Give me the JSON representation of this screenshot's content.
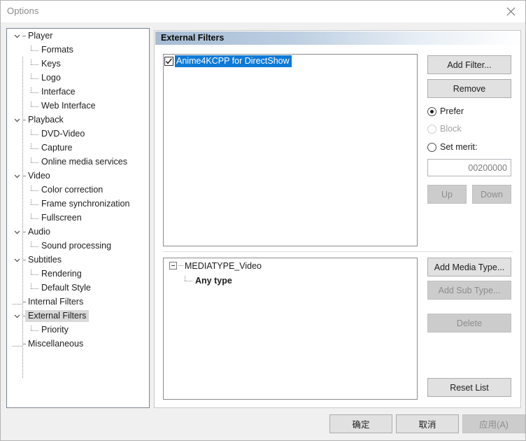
{
  "window": {
    "title": "Options",
    "close_icon": "close-icon"
  },
  "sidebar": {
    "items": [
      {
        "label": "Player",
        "level": "parent",
        "expander": "chevron-down-icon",
        "selected": false
      },
      {
        "label": "Formats",
        "level": "child",
        "expander": "none",
        "selected": false
      },
      {
        "label": "Keys",
        "level": "child",
        "expander": "none",
        "selected": false
      },
      {
        "label": "Logo",
        "level": "child",
        "expander": "none",
        "selected": false
      },
      {
        "label": "Interface",
        "level": "child",
        "expander": "none",
        "selected": false
      },
      {
        "label": "Web Interface",
        "level": "child",
        "expander": "none",
        "selected": false
      },
      {
        "label": "Playback",
        "level": "parent",
        "expander": "chevron-down-icon",
        "selected": false
      },
      {
        "label": "DVD-Video",
        "level": "child",
        "expander": "none",
        "selected": false
      },
      {
        "label": "Capture",
        "level": "child",
        "expander": "none",
        "selected": false
      },
      {
        "label": "Online media services",
        "level": "child",
        "expander": "none",
        "selected": false
      },
      {
        "label": "Video",
        "level": "parent",
        "expander": "chevron-down-icon",
        "selected": false
      },
      {
        "label": "Color correction",
        "level": "child",
        "expander": "none",
        "selected": false
      },
      {
        "label": "Frame synchronization",
        "level": "child",
        "expander": "none",
        "selected": false
      },
      {
        "label": "Fullscreen",
        "level": "child",
        "expander": "none",
        "selected": false
      },
      {
        "label": "Audio",
        "level": "parent",
        "expander": "chevron-down-icon",
        "selected": false
      },
      {
        "label": "Sound processing",
        "level": "child",
        "expander": "none",
        "selected": false
      },
      {
        "label": "Subtitles",
        "level": "parent",
        "expander": "chevron-down-icon",
        "selected": false
      },
      {
        "label": "Rendering",
        "level": "child",
        "expander": "none",
        "selected": false
      },
      {
        "label": "Default Style",
        "level": "child",
        "expander": "none",
        "selected": false
      },
      {
        "label": "Internal Filters",
        "level": "parent",
        "expander": "dots",
        "selected": false
      },
      {
        "label": "External Filters",
        "level": "parent",
        "expander": "chevron-down-icon",
        "selected": true
      },
      {
        "label": "Priority",
        "level": "child",
        "expander": "none",
        "selected": false
      },
      {
        "label": "Miscellaneous",
        "level": "parent",
        "expander": "dots",
        "selected": false
      }
    ]
  },
  "panel": {
    "header": "External Filters",
    "filters": [
      {
        "name": "Anime4KCPP for DirectShow",
        "checked": true,
        "selected": true
      }
    ],
    "buttons": {
      "add_filter": {
        "label": "Add Filter...",
        "enabled": true
      },
      "remove": {
        "label": "Remove",
        "enabled": true
      },
      "up": {
        "label": "Up",
        "enabled": false
      },
      "down": {
        "label": "Down",
        "enabled": false
      },
      "add_media_type": {
        "label": "Add Media Type...",
        "enabled": true
      },
      "add_sub_type": {
        "label": "Add Sub Type...",
        "enabled": false
      },
      "delete": {
        "label": "Delete",
        "enabled": false
      },
      "reset_list": {
        "label": "Reset List",
        "enabled": true
      }
    },
    "merit_mode": {
      "prefer": {
        "label": "Prefer",
        "selected": true,
        "enabled": true
      },
      "block": {
        "label": "Block",
        "selected": false,
        "enabled": false
      },
      "set_merit": {
        "label": "Set merit:",
        "selected": false,
        "enabled": true
      }
    },
    "merit_value": "00200000",
    "media_types": [
      {
        "label": "MEDIATYPE_Video",
        "level": "root",
        "expander": "box-minus-icon"
      },
      {
        "label": "Any type",
        "level": "leaf",
        "expander": "elbow"
      }
    ]
  },
  "footer": {
    "ok": {
      "label": "确定",
      "enabled": true
    },
    "cancel": {
      "label": "取消",
      "enabled": true
    },
    "apply": {
      "label": "应用(A)",
      "enabled": false
    }
  },
  "colors": {
    "selection_blue": "#0d7ad6",
    "tree_selection_gray": "#d9d9d9",
    "dialog_bg": "#f0f0f0",
    "header_gradient_start": "#a6bcd4"
  }
}
